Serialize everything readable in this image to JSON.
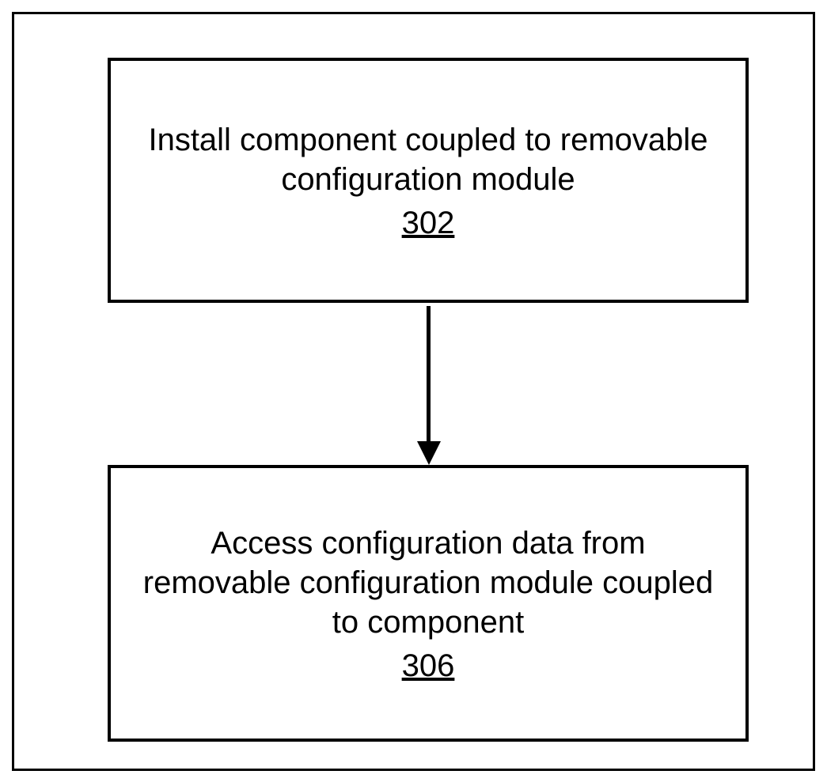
{
  "flow": {
    "step1": {
      "text": "Install component coupled to removable configuration module",
      "ref": "302"
    },
    "step2": {
      "text": "Access configuration data from removable configuration module coupled to component",
      "ref": "306"
    }
  }
}
